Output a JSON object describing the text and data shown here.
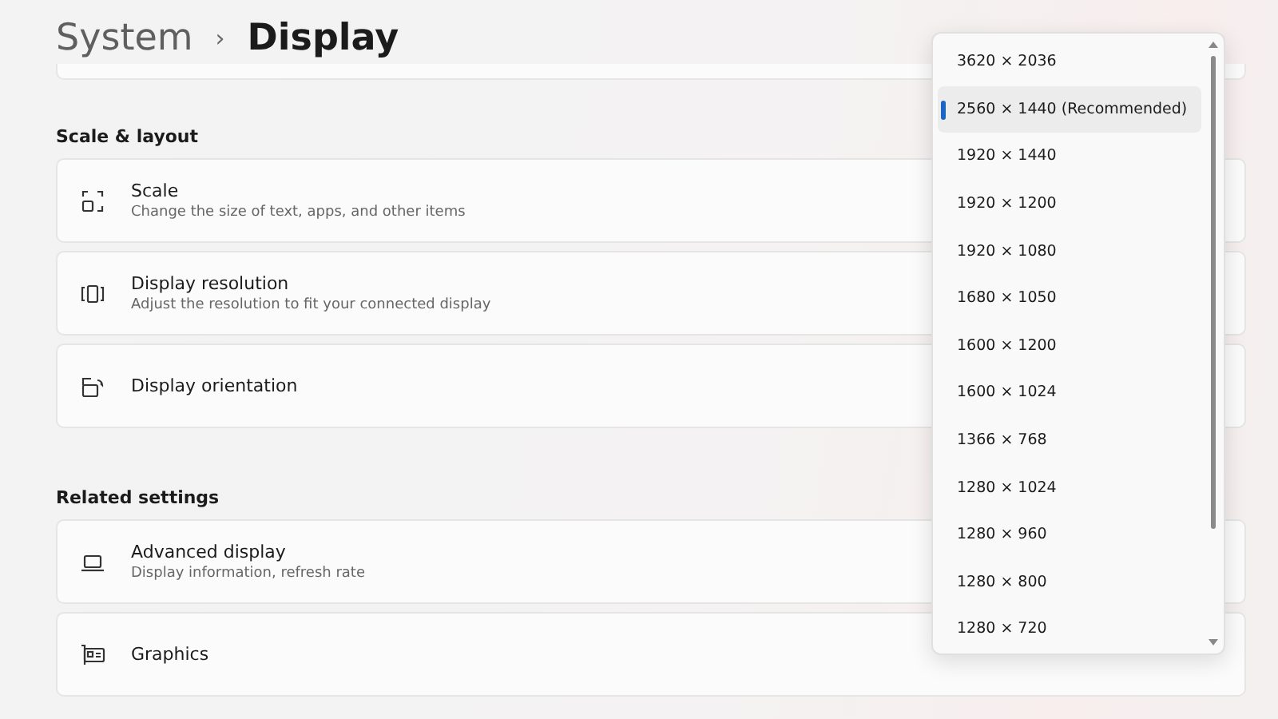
{
  "breadcrumb": {
    "parent": "System",
    "separator": "›",
    "current": "Display"
  },
  "sections": [
    {
      "title": "Scale & layout",
      "items": [
        {
          "kind": "scale",
          "title": "Scale",
          "subtitle": "Change the size of text, apps, and other items"
        },
        {
          "kind": "resolution",
          "title": "Display resolution",
          "subtitle": "Adjust the resolution to fit your connected display"
        },
        {
          "kind": "orientation",
          "title": "Display orientation"
        }
      ]
    },
    {
      "title": "Related settings",
      "items": [
        {
          "kind": "laptop",
          "title": "Advanced display",
          "subtitle": "Display information, refresh rate"
        },
        {
          "kind": "graphics",
          "title": "Graphics"
        }
      ]
    }
  ],
  "resolution_menu": {
    "options": [
      {
        "label": "3620 × 2036",
        "selected": false
      },
      {
        "label": "2560 × 1440 (Recommended)",
        "selected": true
      },
      {
        "label": "1920 × 1440",
        "selected": false
      },
      {
        "label": "1920 × 1200",
        "selected": false
      },
      {
        "label": "1920 × 1080",
        "selected": false
      },
      {
        "label": "1680 × 1050",
        "selected": false
      },
      {
        "label": "1600 × 1200",
        "selected": false
      },
      {
        "label": "1600 × 1024",
        "selected": false
      },
      {
        "label": "1366 × 768",
        "selected": false
      },
      {
        "label": "1280 × 1024",
        "selected": false
      },
      {
        "label": "1280 × 960",
        "selected": false
      },
      {
        "label": "1280 × 800",
        "selected": false
      },
      {
        "label": "1280 × 720",
        "selected": false
      }
    ]
  }
}
